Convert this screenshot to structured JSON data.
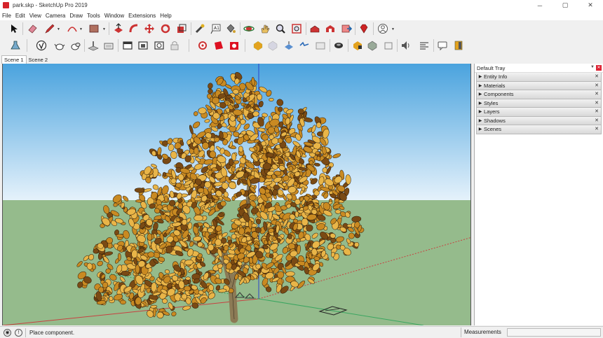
{
  "window": {
    "title": "park.skp - SketchUp Pro 2019",
    "minimize_glyph": "─",
    "maximize_glyph": "▢",
    "close_glyph": "✕"
  },
  "menu": [
    "File",
    "Edit",
    "View",
    "Camera",
    "Draw",
    "Tools",
    "Window",
    "Extensions",
    "Help"
  ],
  "scenes": [
    "Scene 1",
    "Scene 2"
  ],
  "tray": {
    "title": "Default Tray",
    "pin_glyph": "▼",
    "close_glyph": "✕",
    "panels": [
      "Entity Info",
      "Materials",
      "Components",
      "Styles",
      "Layers",
      "Shadows",
      "Scenes"
    ],
    "panel_arrow": "▶",
    "panel_close": "✕"
  },
  "status": {
    "text": "Place component.",
    "geo_glyph": "◉",
    "info_glyph": "!",
    "measurements_label": "Measurements",
    "measurements_value": ""
  },
  "colors": {
    "sky_top": "#4aa3de",
    "sky_bottom": "#e6f2fb",
    "ground": "#95bb8c",
    "axis_blue": "#2a45c8",
    "axis_red": "#c84040",
    "axis_green": "#3aa660",
    "leaf_main": "#c98a22",
    "leaf_light": "#e9b548",
    "leaf_dark": "#7a4a14",
    "trunk": "#8c7a55"
  },
  "icons": {
    "toolbar1": [
      "select-arrow-icon",
      "eraser-icon",
      "pencil-line-icon",
      "arc-icon",
      "rectangle-icon",
      "push-pull-icon",
      "follow-me-icon",
      "move-icon",
      "rotate-icon",
      "scale-icon",
      "tape-measure-icon",
      "text-icon",
      "paint-bucket-icon",
      "orbit-icon",
      "pan-icon",
      "zoom-icon",
      "zoom-extents-icon",
      "warehouse-icon",
      "extension-warehouse-icon",
      "send-to-layout-icon",
      "ruby-icon",
      "account-icon"
    ],
    "toolbar2": [
      "instructor-icon",
      "validate-icon",
      "teapot-icon",
      "teapot-group-icon",
      "sandbox-icon",
      "flatten-icon",
      "section-icon",
      "section-fill-icon",
      "section-cut-icon",
      "lock-icon",
      "camera-position-icon",
      "walk-icon",
      "position-camera-icon",
      "style-icon",
      "xray-icon",
      "wireframe-icon",
      "hidden-line-icon",
      "shaded-icon",
      "textured-icon",
      "monochrome-icon",
      "shadow-icon",
      "fog-icon",
      "sound-icon",
      "align-icon",
      "chat-icon",
      "book-icon"
    ]
  }
}
